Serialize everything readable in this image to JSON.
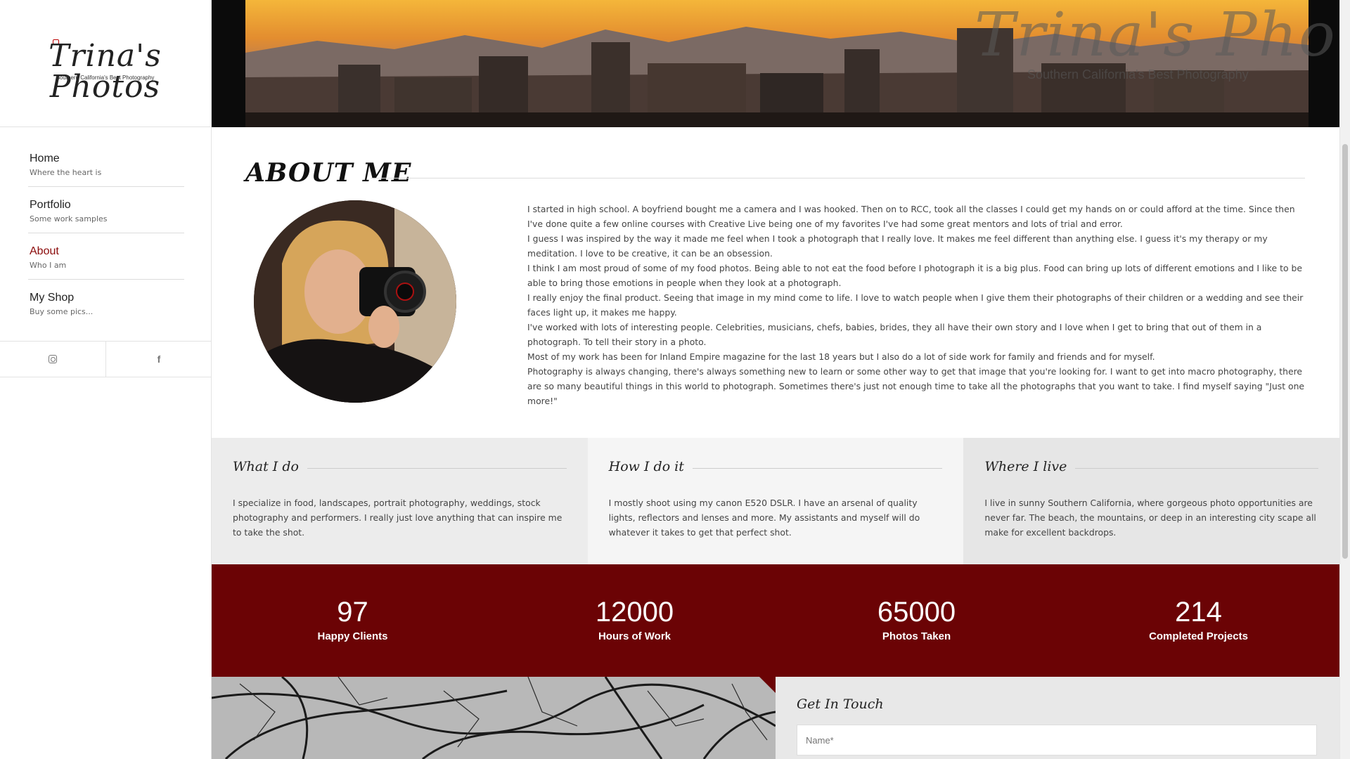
{
  "sidebar": {
    "logo": {
      "title": "Trina's Photos",
      "tagline": "Southern California's Best Photography"
    },
    "nav": [
      {
        "label": "Home",
        "sub": "Where the heart is"
      },
      {
        "label": "Portfolio",
        "sub": "Some work samples"
      },
      {
        "label": "About",
        "sub": "Who I am",
        "active": true
      },
      {
        "label": "My Shop",
        "sub": "Buy some pics..."
      }
    ],
    "social": [
      "instagram-icon",
      "facebook-icon"
    ],
    "facebook_glyph": "f"
  },
  "banner": {
    "watermark_title": "Trina's Photos",
    "watermark_sub": "Southern California's Best Photography"
  },
  "about": {
    "heading": "ABOUT ME",
    "paragraphs": [
      "I started in high school. A boyfriend bought me a camera and I was hooked. Then on to RCC, took all the classes I could get my hands on or could afford at the time. Since then I've done quite a few online courses with Creative Live being one of my favorites I've had some great mentors and lots of trial and error.",
      "I guess I was inspired by the way it made me feel when I took a photograph that I really love. It makes me feel different than anything else. I guess it's my therapy or my meditation. I love to be creative, it can be an obsession.",
      "I think I am most proud of some of my food photos. Being able to not eat the food before I photograph it is a big plus. Food can bring up lots of different emotions and I like to be able to bring those emotions in people when they look at a photograph.",
      "I really enjoy the final product. Seeing that image in my mind come to life. I  love to watch people when I give them their photographs of their children or a wedding and see their faces light up, it makes me happy.",
      "I've worked with lots of interesting people. Celebrities, musicians, chefs, babies, brides, they all have their own story and I love when I get to bring that out  of them in a photograph. To tell their story in a photo.",
      "Most of my work has been for Inland Empire magazine for the last 18 years but I also do a lot of side work for family and friends and for myself.",
      "Photography is always changing, there's always something new to learn or some other way to get that image that you're looking for. I want to get into macro photography, there are so many beautiful things in this world to photograph. Sometimes there's just not enough time to take all the photographs that you want to take. I find myself saying \"Just one more!\""
    ]
  },
  "features": [
    {
      "title": "What I do",
      "text": "I specialize in food, landscapes, portrait photography, weddings, stock photography and performers. I really just love anything that can inspire me to take the shot."
    },
    {
      "title": "How I do it",
      "text": "I mostly shoot using my canon E520 DSLR. I have an arsenal of quality lights, reflectors and lenses and more. My assistants and myself will do whatever it takes to get that perfect shot."
    },
    {
      "title": "Where I live",
      "text": "I live in sunny Southern California, where gorgeous photo opportunities are never far. The beach, the mountains, or deep in an interesting city scape all make for excellent backdrops."
    }
  ],
  "stats": [
    {
      "number": "97",
      "label": "Happy Clients"
    },
    {
      "number": "12000",
      "label": "Hours of Work"
    },
    {
      "number": "65000",
      "label": "Photos Taken"
    },
    {
      "number": "214",
      "label": "Completed Projects"
    }
  ],
  "contact": {
    "title": "Get In Touch",
    "name_placeholder": "Name*"
  },
  "colors": {
    "accent": "#6b0305",
    "active_nav": "#8b0a0a"
  }
}
